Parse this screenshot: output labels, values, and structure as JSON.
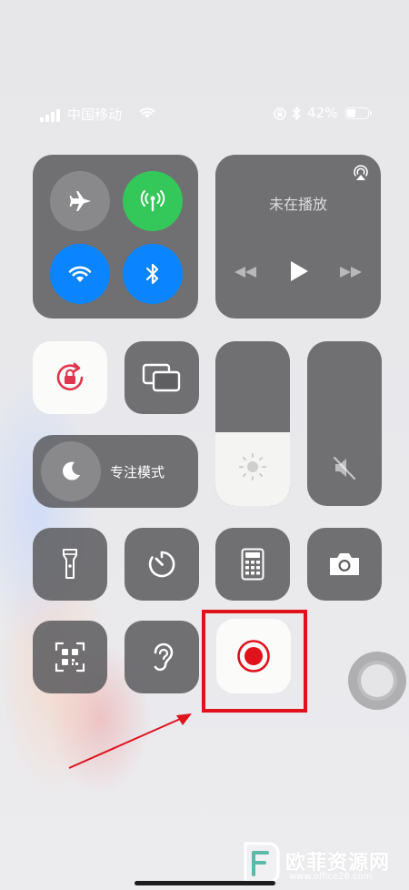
{
  "status_bar": {
    "carrier": "中国移动",
    "battery_percent": "42%",
    "battery_level": 0.42
  },
  "now_playing": {
    "title": "未在播放"
  },
  "focus": {
    "label": "专注模式"
  },
  "sliders": {
    "brightness_level": 0.45
  },
  "watermark": {
    "brand": "欧菲资源网",
    "url": "www.office26.com"
  },
  "colors": {
    "cellular_green": "#34c759",
    "active_blue": "#0a84ff",
    "lock_red": "#e0364d",
    "record_red": "#e0121c",
    "annotation_red": "#e0121c"
  }
}
